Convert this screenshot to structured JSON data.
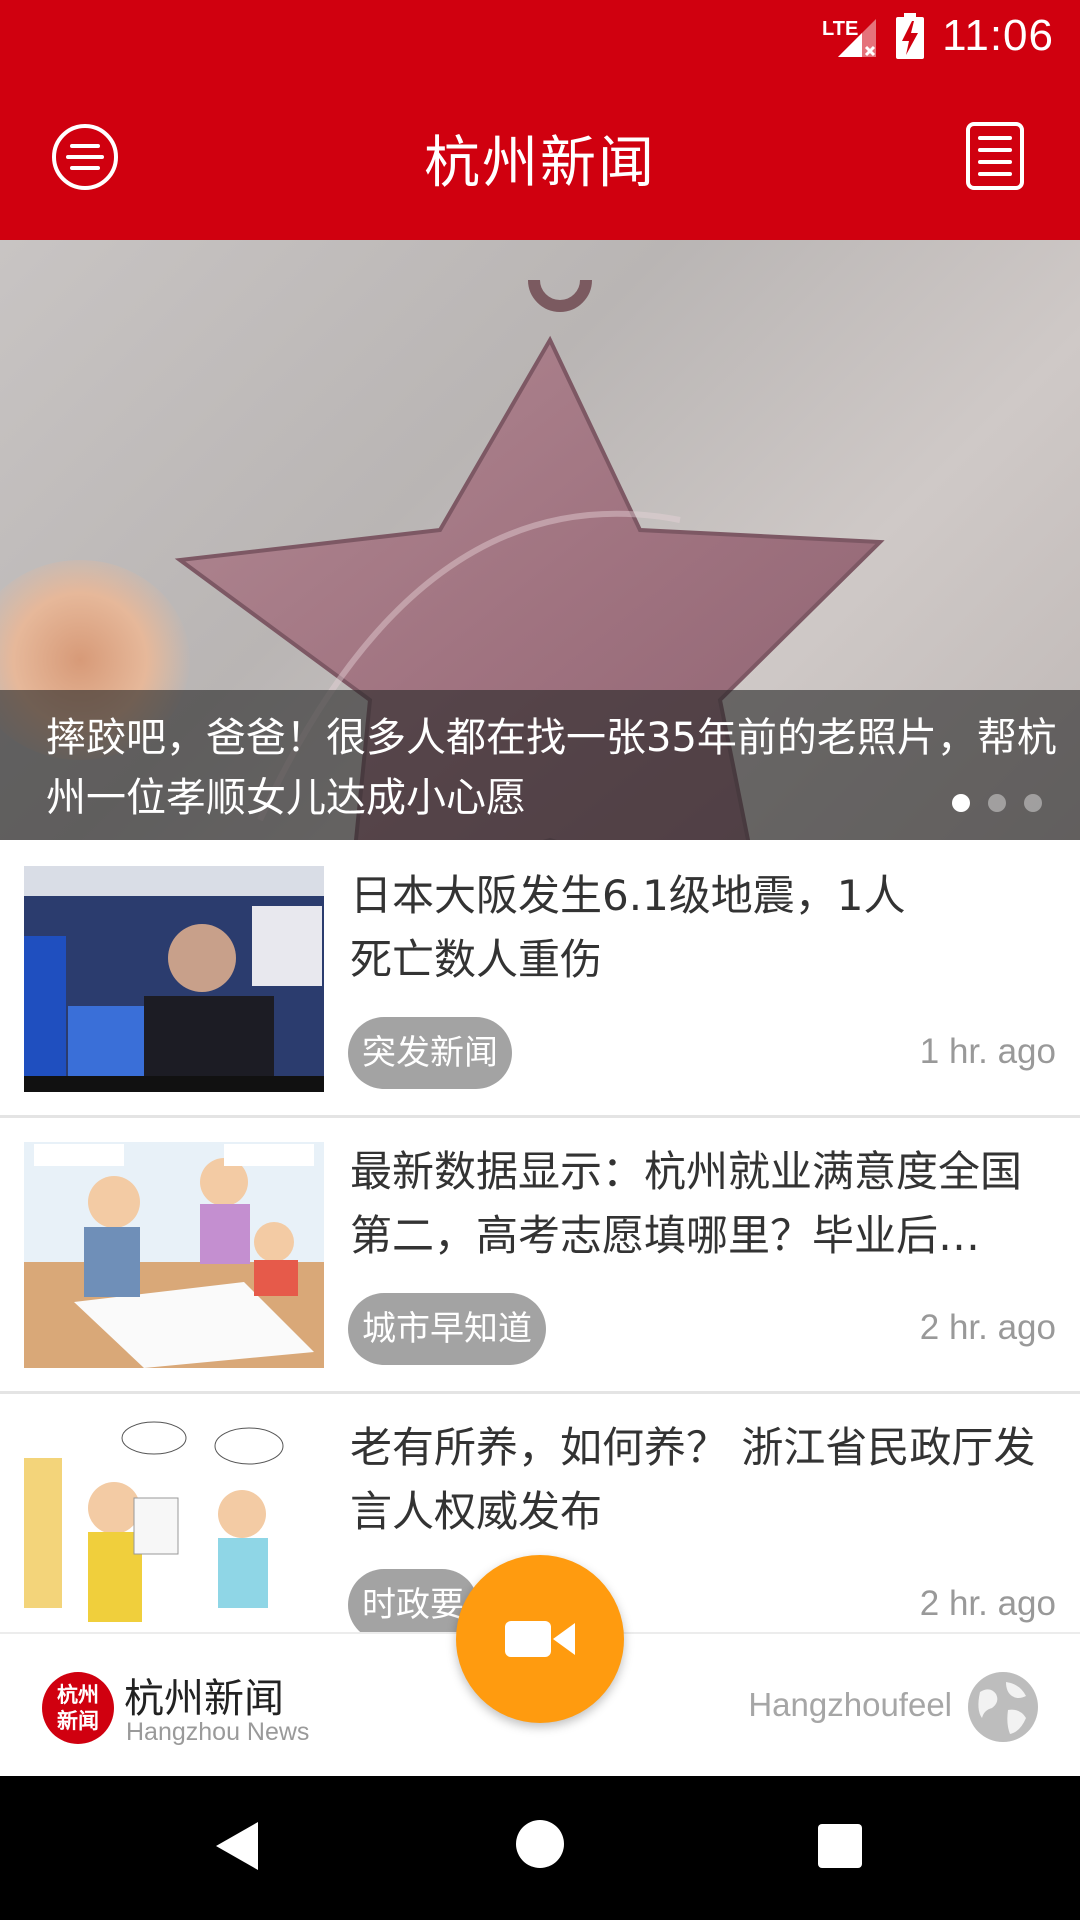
{
  "status_bar": {
    "network": "LTE",
    "time": "11:06"
  },
  "app_bar": {
    "title": "杭州新闻",
    "menu_icon": "menu-circle-icon",
    "doc_icon": "document-list-icon"
  },
  "hero": {
    "caption": "摔跤吧，爸爸！很多人都在找一张35年前的老照片，帮杭州一位孝顺女儿达成小心愿",
    "dots_total": 3,
    "dots_active": 0
  },
  "news": [
    {
      "title": "日本大阪发生6.1级地震，1人\n死亡数人重伤",
      "tag": "突发新闻",
      "time": "1 hr. ago"
    },
    {
      "title": "最新数据显示：杭州就业满意度全国第二，高考志愿填哪里？毕业后…",
      "tag": "城市早知道",
      "time": "2 hr. ago"
    },
    {
      "title": "老有所养，如何养？ 浙江省民政厅发言人权威发布",
      "tag": "时政要",
      "time": "2 hr. ago"
    }
  ],
  "brand": {
    "logo_text": "杭州新闻",
    "name": "杭州新闻",
    "subtitle": "Hangzhou News",
    "partner": "Hangzhoufeel"
  },
  "colors": {
    "primary": "#d0000f",
    "fab": "#ff9b0f",
    "tag_bg": "#a3a3a3"
  }
}
